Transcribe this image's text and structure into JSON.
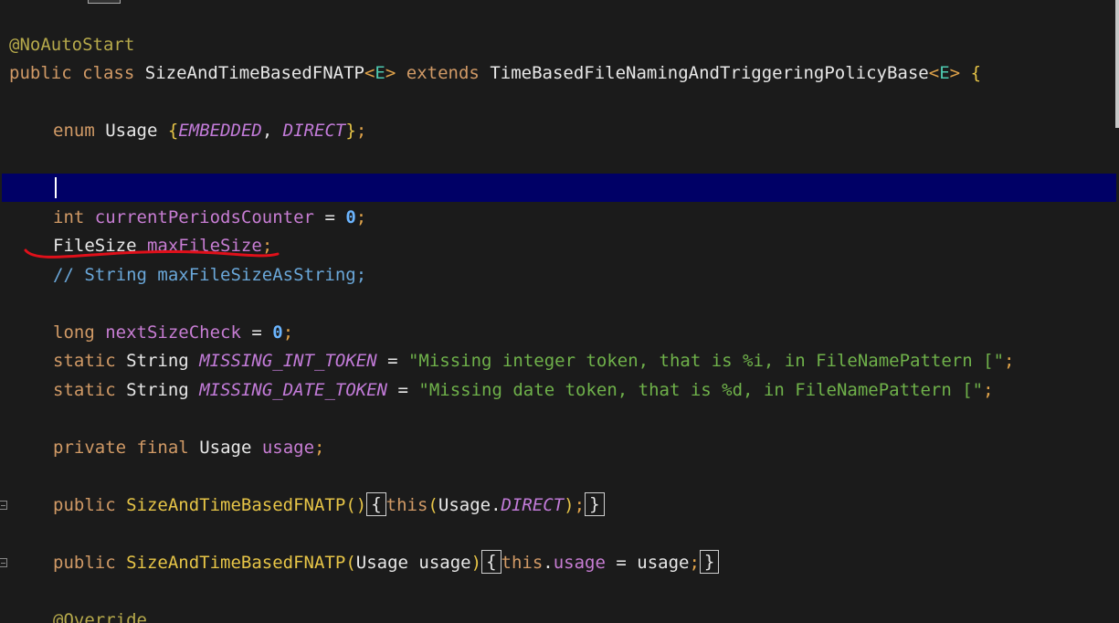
{
  "editor": {
    "language": "java",
    "lines": {
      "annotation": "@NoAutoStart",
      "class_decl": {
        "kw_public": "public",
        "kw_class": "class",
        "class_name": "SizeAndTimeBasedFNATP",
        "lt": "<",
        "generic": "E",
        "gt": ">",
        "kw_extends": "extends",
        "base_class": "TimeBasedFileNamingAndTriggeringPolicyBase",
        "lt2": "<",
        "generic2": "E",
        "gt2": ">",
        "open_brace": "{"
      },
      "enum_decl": {
        "kw_enum": "enum",
        "name": "Usage",
        "open": "{",
        "const1": "EMBEDDED",
        "comma": ", ",
        "const2": "DIRECT",
        "close": "}",
        "semi": ";"
      },
      "counter_decl": {
        "type": "int",
        "name": "currentPeriodsCounter",
        "eq": " = ",
        "value": "0",
        "semi": ";"
      },
      "filesize_decl": {
        "type": "FileSize",
        "name": "maxFileSize",
        "semi": ";"
      },
      "comment": "// String maxFileSizeAsString;",
      "next_check_decl": {
        "type": "long",
        "name": "nextSizeCheck",
        "eq": " = ",
        "value": "0",
        "semi": ";"
      },
      "missing_int": {
        "kw_static": "static",
        "type": "String",
        "name": "MISSING_INT_TOKEN",
        "eq": " = ",
        "value": "\"Missing integer token, that is %i, in FileNamePattern [\"",
        "semi": ";"
      },
      "missing_date": {
        "kw_static": "static",
        "type": "String",
        "name": "MISSING_DATE_TOKEN",
        "eq": " = ",
        "value": "\"Missing date token, that is %d, in FileNamePattern [\"",
        "semi": ";"
      },
      "usage_field": {
        "kw_private": "private",
        "kw_final": "final",
        "type": "Usage",
        "name": "usage",
        "semi": ";"
      },
      "ctor1": {
        "kw_public": "public",
        "name": "SizeAndTimeBasedFNATP",
        "parens": "()",
        "open": "{",
        "kw_this": "this",
        "lp": "(",
        "arg_type": "Usage",
        "dot": ".",
        "arg_const": "DIRECT",
        "rp": ")",
        "semi": ";",
        "close": "}"
      },
      "ctor2": {
        "kw_public": "public",
        "name": "SizeAndTimeBasedFNATP",
        "lp": "(",
        "param_type": "Usage",
        "param_name": " usage",
        "rp": ")",
        "open": "{",
        "kw_this": "this",
        "dot": ".",
        "field": "usage",
        "eq": " = ",
        "rhs": "usage",
        "semi": ";",
        "close": "}"
      },
      "override": "@Override"
    },
    "colors": {
      "background": "#1b1b1b",
      "caret_line": "#000066",
      "keyword": "#d19a66",
      "string": "#6fb14a",
      "constant": "#c27bd8",
      "comment": "#6aa7d9",
      "number": "#6bb5ff",
      "annotation_mark": "#e0101a"
    }
  }
}
